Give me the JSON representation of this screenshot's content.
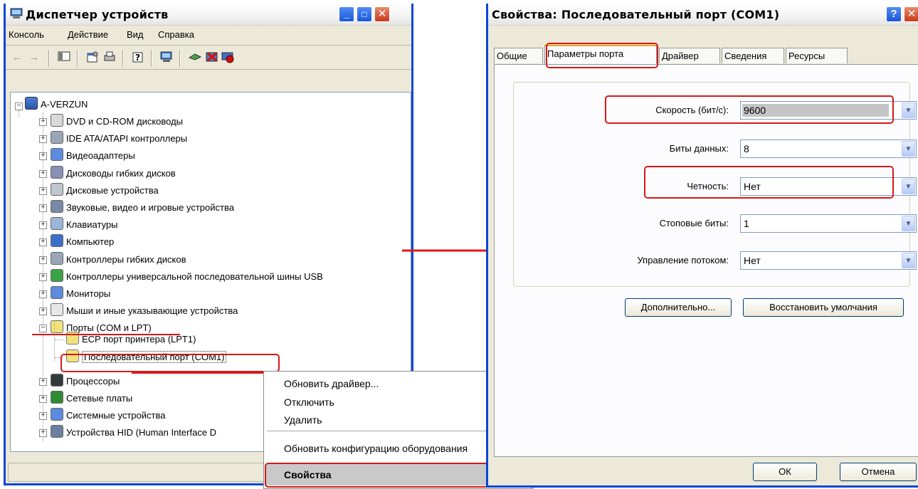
{
  "device_manager": {
    "title": "Диспетчер устройств",
    "menu": [
      "Консоль",
      "Действие",
      "Вид",
      "Справка"
    ],
    "tree": {
      "root": "A-VERZUN",
      "categories": [
        {
          "label": "DVD и CD-ROM дисководы",
          "icon": "dvd-drive-icon"
        },
        {
          "label": "IDE ATA/ATAPI контроллеры",
          "icon": "ide-controller-icon"
        },
        {
          "label": "Видеоадаптеры",
          "icon": "display-adapter-icon"
        },
        {
          "label": "Дисководы гибких дисков",
          "icon": "floppy-drive-icon"
        },
        {
          "label": "Дисковые устройства",
          "icon": "disk-drive-icon"
        },
        {
          "label": "Звуковые, видео и игровые устройства",
          "icon": "sound-device-icon"
        },
        {
          "label": "Клавиатуры",
          "icon": "keyboard-icon"
        },
        {
          "label": "Компьютер",
          "icon": "computer-icon"
        },
        {
          "label": "Контроллеры гибких дисков",
          "icon": "floppy-controller-icon"
        },
        {
          "label": "Контроллеры универсальной последовательной шины USB",
          "icon": "usb-icon"
        },
        {
          "label": "Мониторы",
          "icon": "monitor-icon"
        },
        {
          "label": "Мыши и иные указывающие устройства",
          "icon": "mouse-icon"
        },
        {
          "label": "Порты (COM и LPT)",
          "icon": "port-icon"
        },
        {
          "label": "Процессоры",
          "icon": "processor-icon"
        },
        {
          "label": "Сетевые платы",
          "icon": "network-card-icon"
        },
        {
          "label": "Системные устройства",
          "icon": "system-device-icon"
        },
        {
          "label": "Устройства HID (Human Interface D",
          "icon": "hid-icon"
        }
      ],
      "ports_children": [
        "ECP порт принтера (LPT1)",
        "Последовательный порт (COM1)"
      ]
    }
  },
  "context_menu": {
    "items": [
      "Обновить драйвер...",
      "Отключить",
      "Удалить",
      "Обновить конфигурацию оборудования",
      "Свойства"
    ]
  },
  "properties": {
    "title": "Свойства: Последовательный порт (COM1)",
    "tabs": [
      "Общие",
      "Параметры порта",
      "Драйвер",
      "Сведения",
      "Ресурсы"
    ],
    "active_tab": "Параметры порта",
    "fields": [
      {
        "label": "Скорость (бит/с):",
        "value": "9600"
      },
      {
        "label": "Биты данных:",
        "value": "8"
      },
      {
        "label": "Четность:",
        "value": "Нет"
      },
      {
        "label": "Стоповые биты:",
        "value": "1"
      },
      {
        "label": "Управление потоком:",
        "value": "Нет"
      }
    ],
    "advanced_button": "Дополнительно...",
    "restore_button": "Восстановить умолчания",
    "ok_button": "ОК",
    "cancel_button": "Отмена"
  },
  "colors": {
    "highlight": "#d51919",
    "titlebar_accent": "#0846d8"
  }
}
